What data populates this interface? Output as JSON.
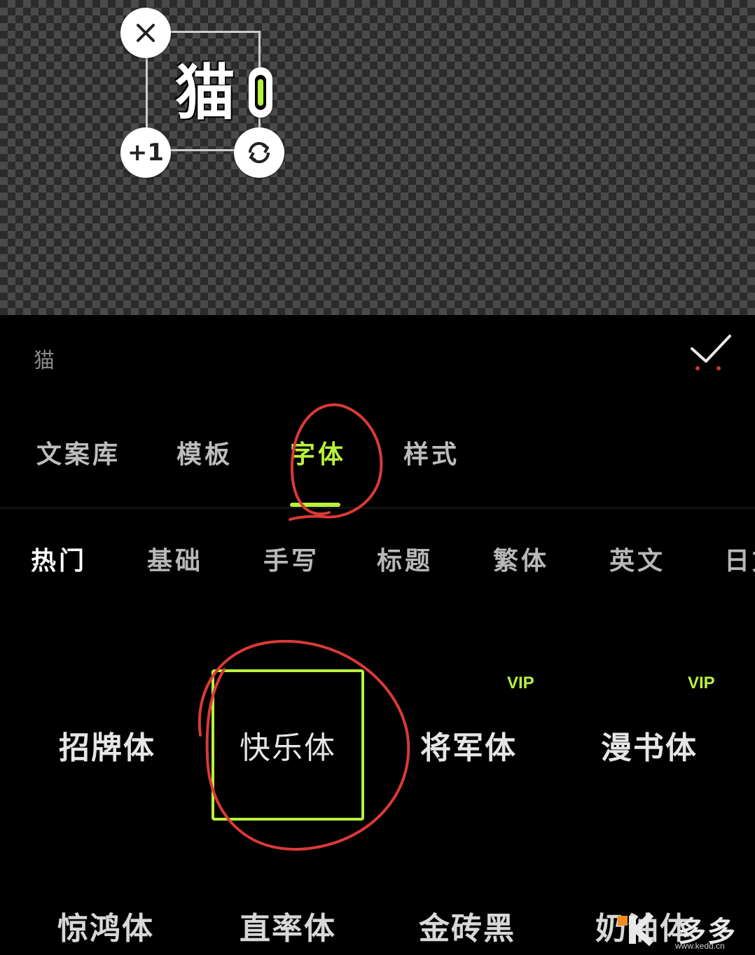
{
  "canvas": {
    "text": "猫",
    "duplicate_label": "+1"
  },
  "input": {
    "value": "猫"
  },
  "tabs": [
    {
      "label": "文案库",
      "active": false
    },
    {
      "label": "模板",
      "active": false
    },
    {
      "label": "字体",
      "active": true
    },
    {
      "label": "样式",
      "active": false
    }
  ],
  "categories": [
    {
      "label": "热门",
      "active": true
    },
    {
      "label": "基础",
      "active": false
    },
    {
      "label": "手写",
      "active": false
    },
    {
      "label": "标题",
      "active": false
    },
    {
      "label": "繁体",
      "active": false
    },
    {
      "label": "英文",
      "active": false
    },
    {
      "label": "日文",
      "active": false
    }
  ],
  "fonts_row1": [
    {
      "label": "招牌体",
      "vip": ""
    },
    {
      "label": "快乐体",
      "vip": "",
      "selected": true
    },
    {
      "label": "将军体",
      "vip": "VIP"
    },
    {
      "label": "漫书体",
      "vip": "VIP"
    }
  ],
  "fonts_row2": [
    {
      "label": "惊鸿体"
    },
    {
      "label": "直率体"
    },
    {
      "label": "金砖黑"
    },
    {
      "label": "奶油体"
    }
  ],
  "watermark": {
    "brand": "多多",
    "url": "www.kedd.cn"
  },
  "colors": {
    "accent": "#b8f23c",
    "annotation": "#d93a36"
  }
}
